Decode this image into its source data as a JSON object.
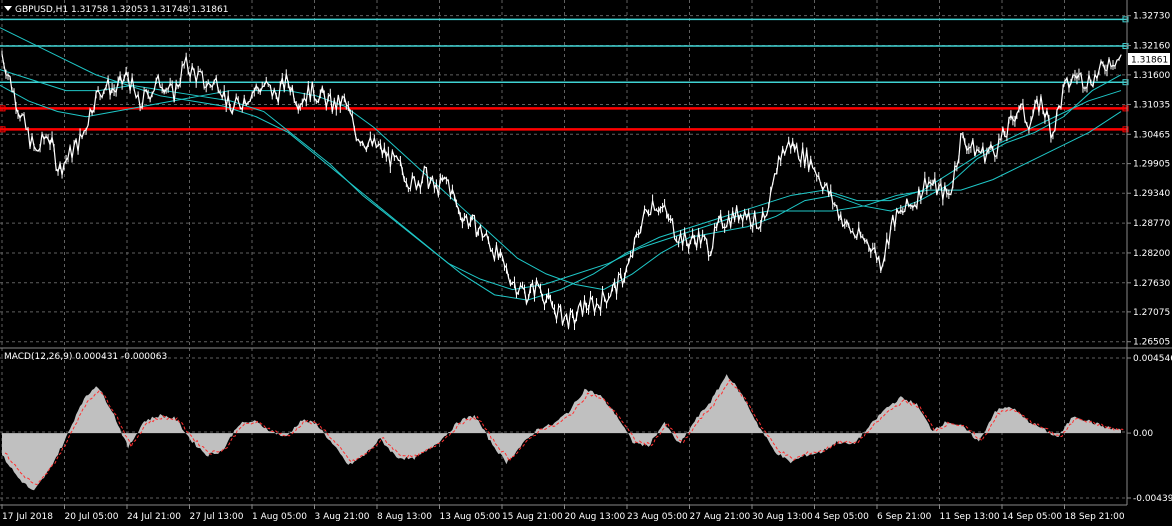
{
  "header": {
    "symbol_line": "GBPUSD,H1  1.31758 1.32053 1.31748 1.31861",
    "menu_icon": "triangle-down-icon"
  },
  "macd_header": "MACD(12,26,9) 0.000431 -0.000063",
  "colors": {
    "background": "#000000",
    "grid": "#606060",
    "candles": "#ffffff",
    "ma": "#1fc7c7",
    "cyan_level": "#3fd2d2",
    "red_level": "#ff0000",
    "macd_hist": "#c0c0c0",
    "macd_signal": "#ff3030",
    "price_box": "#ffffff"
  },
  "current_price": "1.31861",
  "chart_data": [
    {
      "type": "line",
      "pane": "price",
      "ylim": [
        1.265,
        1.328
      ],
      "y_ticks": [
        "1.32730",
        "1.32160",
        "1.31600",
        "1.31035",
        "1.30465",
        "1.29905",
        "1.29340",
        "1.28770",
        "1.28200",
        "1.27630",
        "1.27075",
        "1.26505"
      ],
      "x_ticks": [
        "17 Jul 2018",
        "20 Jul 05:00",
        "24 Jul 21:00",
        "27 Jul 13:00",
        "1 Aug 05:00",
        "3 Aug 21:00",
        "8 Aug 13:00",
        "13 Aug 05:00",
        "15 Aug 21:00",
        "20 Aug 13:00",
        "23 Aug 05:00",
        "27 Aug 21:00",
        "30 Aug 13:00",
        "4 Sep 05:00",
        "6 Sep 21:00",
        "11 Sep 13:00",
        "14 Sep 05:00",
        "18 Sep 21:00"
      ],
      "horizontal_levels": {
        "cyan": [
          1.3266,
          1.3215,
          1.3146
        ],
        "red": [
          1.3096,
          1.3056
        ]
      },
      "price_path": [
        1.32,
        1.313,
        1.306,
        1.301,
        1.305,
        1.298,
        1.301,
        1.304,
        1.311,
        1.314,
        1.313,
        1.316,
        1.31,
        1.313,
        1.315,
        1.312,
        1.318,
        1.316,
        1.314,
        1.315,
        1.309,
        1.311,
        1.313,
        1.314,
        1.312,
        1.315,
        1.311,
        1.313,
        1.312,
        1.31,
        1.311,
        1.305,
        1.303,
        1.302,
        1.3,
        1.298,
        1.295,
        1.297,
        1.294,
        1.296,
        1.29,
        1.288,
        1.286,
        1.283,
        1.279,
        1.276,
        1.274,
        1.276,
        1.272,
        1.27,
        1.269,
        1.272,
        1.272,
        1.274,
        1.276,
        1.28,
        1.288,
        1.292,
        1.29,
        1.286,
        1.284,
        1.285,
        1.283,
        1.288,
        1.289,
        1.29,
        1.288,
        1.288,
        1.3,
        1.303,
        1.301,
        1.299,
        1.295,
        1.291,
        1.287,
        1.285,
        1.284,
        1.28,
        1.288,
        1.29,
        1.292,
        1.296,
        1.294,
        1.293,
        1.304,
        1.302,
        1.301,
        1.302,
        1.305,
        1.31,
        1.307,
        1.311,
        1.305,
        1.313,
        1.316,
        1.315,
        1.316,
        1.319,
        1.319
      ],
      "ma_fast": [
        1.314,
        1.311,
        1.309,
        1.308,
        1.309,
        1.31,
        1.311,
        1.312,
        1.313,
        1.313,
        1.313,
        1.312,
        1.31,
        1.306,
        1.301,
        1.296,
        1.291,
        1.286,
        1.281,
        1.278,
        1.276,
        1.275,
        1.278,
        1.282,
        1.285,
        1.286,
        1.287,
        1.289,
        1.292,
        1.293,
        1.291,
        1.29,
        1.292,
        1.295,
        1.3,
        1.303,
        1.305,
        1.308,
        1.313,
        1.316
      ],
      "ma_slow": [
        1.325,
        1.322,
        1.319,
        1.316,
        1.314,
        1.312,
        1.311,
        1.31,
        1.308,
        1.305,
        1.3,
        1.295,
        1.29,
        1.285,
        1.28,
        1.277,
        1.275,
        1.276,
        1.278,
        1.28,
        1.283,
        1.285,
        1.287,
        1.289,
        1.29,
        1.29,
        1.29,
        1.291,
        1.293,
        1.294,
        1.294,
        1.296,
        1.299,
        1.302,
        1.305,
        1.309
      ],
      "ma_mid": [
        1.317,
        1.315,
        1.313,
        1.313,
        1.314,
        1.313,
        1.312,
        1.311,
        1.309,
        1.304,
        1.299,
        1.293,
        1.288,
        1.283,
        1.278,
        1.274,
        1.273,
        1.275,
        1.278,
        1.282,
        1.285,
        1.287,
        1.289,
        1.291,
        1.293,
        1.294,
        1.292,
        1.292,
        1.294,
        1.298,
        1.302,
        1.305,
        1.308,
        1.311,
        1.313
      ]
    },
    {
      "type": "bar",
      "pane": "macd",
      "ylim": [
        -0.004399,
        0.004546
      ],
      "y_ticks": [
        "0.004546",
        "0.00",
        "-0.004399"
      ],
      "histogram": [
        -1.5,
        -3.0,
        -4.0,
        -2.5,
        -0.5,
        2.0,
        3.3,
        1.5,
        -1.0,
        0.8,
        1.2,
        1.0,
        -0.5,
        -1.5,
        -1.2,
        0.6,
        0.8,
        0.2,
        -0.3,
        0.9,
        0.6,
        -0.8,
        -2.2,
        -1.5,
        -0.4,
        -1.6,
        -1.8,
        -1.2,
        -0.3,
        0.8,
        1.2,
        -0.6,
        -2.0,
        -0.8,
        0.3,
        0.6,
        1.5,
        3.0,
        2.5,
        1.2,
        -0.6,
        -0.9,
        0.7,
        -0.8,
        0.9,
        2.2,
        4.0,
        2.5,
        0.5,
        -1.2,
        -2.0,
        -1.5,
        -1.3,
        -0.6,
        -0.8,
        0.4,
        1.6,
        2.4,
        2.0,
        0.2,
        0.8,
        0.4,
        -0.6,
        1.5,
        1.8,
        0.9,
        0.3,
        -0.3,
        1.2,
        0.8,
        0.4,
        0.2
      ],
      "signal_color": "#ff3030"
    }
  ]
}
